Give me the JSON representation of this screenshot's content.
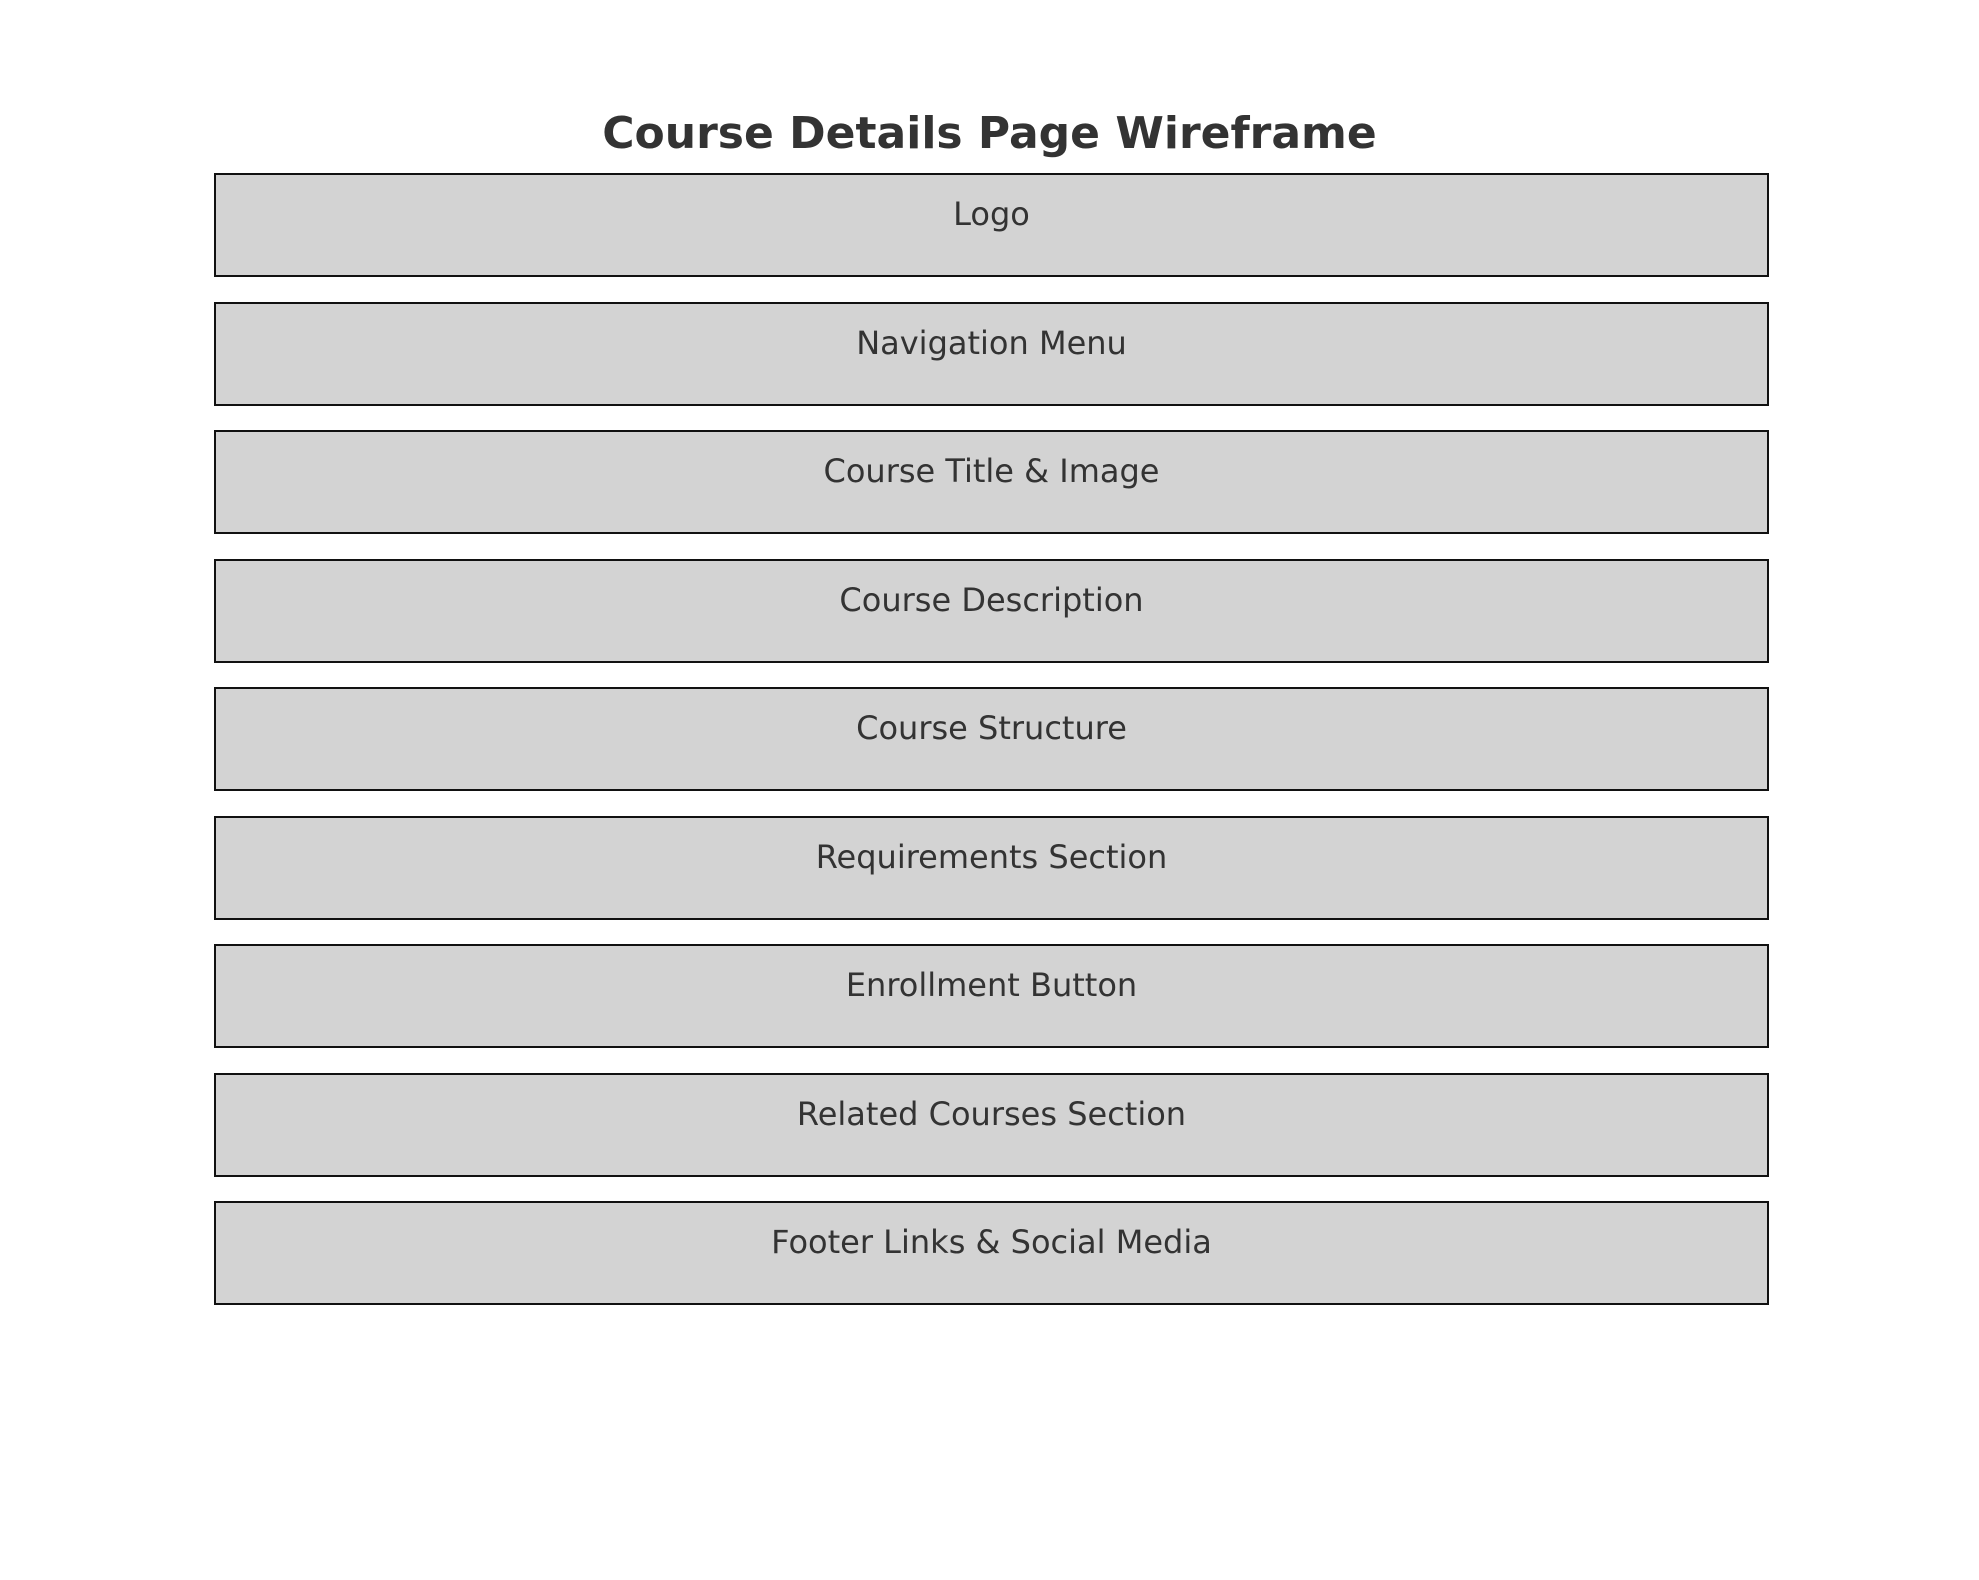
{
  "title": "Course Details Page Wireframe",
  "sections": [
    {
      "label": "Logo"
    },
    {
      "label": "Navigation Menu"
    },
    {
      "label": "Course Title & Image"
    },
    {
      "label": "Course Description"
    },
    {
      "label": "Course Structure"
    },
    {
      "label": "Requirements Section"
    },
    {
      "label": "Enrollment Button"
    },
    {
      "label": "Related Courses Section"
    },
    {
      "label": "Footer Links & Social Media"
    }
  ],
  "colors": {
    "block_fill": "#d3d3d3",
    "block_border": "#111111",
    "text": "#333333",
    "background": "#ffffff"
  }
}
